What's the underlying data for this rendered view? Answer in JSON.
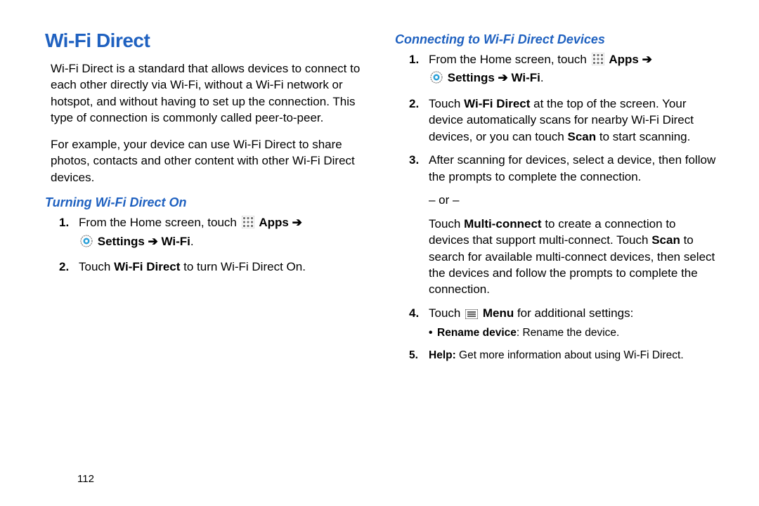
{
  "pageNumber": "112",
  "title": "Wi-Fi Direct",
  "intro1": "Wi-Fi Direct is a standard that allows devices to connect to each other directly via Wi-Fi, without a Wi-Fi network or hotspot, and without having to set up the connection. This type of connection is commonly called peer-to-peer.",
  "intro2": "For example, your device can use Wi-Fi Direct to share photos, contacts and other content with other Wi-Fi Direct devices.",
  "sub1": "Turning Wi-Fi Direct On",
  "s1_1a": "From the Home screen, touch ",
  "apps": "Apps",
  "settings": "Settings",
  "wifi": "Wi-Fi",
  "s1_2a": "Touch ",
  "s1_2b": "Wi-Fi Direct",
  "s1_2c": " to turn Wi-Fi Direct On.",
  "sub2": "Connecting to Wi-Fi Direct Devices",
  "s2_1a": "From the Home screen, touch ",
  "s2_2a": "Touch ",
  "s2_2b": "Wi-Fi Direct",
  "s2_2c": " at the top of the screen. Your device automatically scans for nearby Wi-Fi Direct devices, or you can touch ",
  "s2_2d": "Scan",
  "s2_2e": " to start scanning.",
  "s2_3": "After scanning for devices, select a device, then follow the prompts to complete the connection.",
  "or": "– or –",
  "mc1": "Touch ",
  "mc2": "Multi-connect",
  "mc3": " to create a connection to devices that support multi-connect. Touch ",
  "mc4": "Scan",
  "mc5": " to search for available multi-connect devices, then select the devices and follow the prompts to complete the connection.",
  "s2_4a": "Touch ",
  "menu": "Menu",
  "s2_4b": " for additional settings:",
  "bullet1a": "Rename device",
  "bullet1b": ": Rename the device.",
  "help1": "Help:",
  "help2": " Get more information about using Wi-Fi Direct."
}
